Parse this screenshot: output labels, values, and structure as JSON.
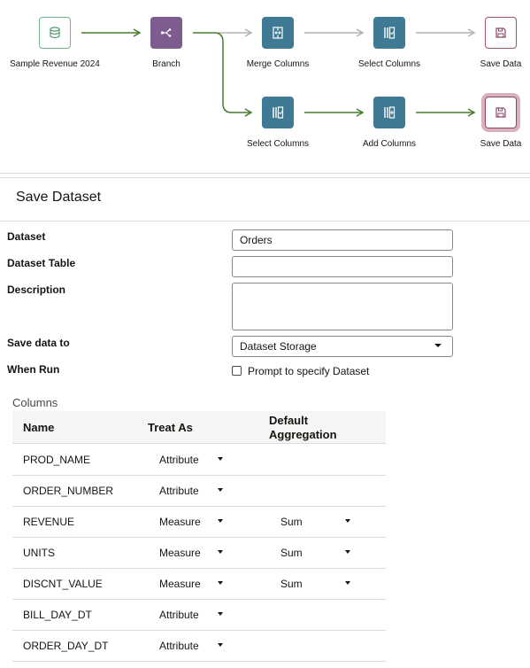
{
  "flow": {
    "nodes": [
      {
        "label": "Sample Revenue 2024",
        "icon": "database-icon"
      },
      {
        "label": "Branch",
        "icon": "branch-icon"
      },
      {
        "label": "Merge Columns",
        "icon": "merge-columns-icon"
      },
      {
        "label": "Select Columns",
        "icon": "select-columns-icon"
      },
      {
        "label": "Save Data",
        "icon": "save-icon"
      },
      {
        "label": "Select Columns",
        "icon": "select-columns-icon"
      },
      {
        "label": "Add Columns",
        "icon": "add-columns-icon"
      },
      {
        "label": "Save Data",
        "icon": "save-icon"
      }
    ],
    "colors": {
      "active_edge": "#4a7a2c",
      "inactive_edge": "#b5b3b0",
      "selected_ring": "#d8b2be"
    }
  },
  "panel": {
    "title": "Save Dataset",
    "dataset_label": "Dataset",
    "dataset_value": "Orders",
    "dataset_table_label": "Dataset Table",
    "dataset_table_value": "",
    "description_label": "Description",
    "description_value": "",
    "save_to_label": "Save data to",
    "save_to_value": "Dataset Storage",
    "when_run_label": "When Run",
    "prompt_label": "Prompt to specify Dataset",
    "prompt_checked": false
  },
  "columns": {
    "title": "Columns",
    "headers": {
      "name": "Name",
      "treat_as": "Treat As",
      "agg_line1": "Default",
      "agg_line2": "Aggregation"
    },
    "rows": [
      {
        "name": "PROD_NAME",
        "treat_as": "Attribute",
        "agg": ""
      },
      {
        "name": "ORDER_NUMBER",
        "treat_as": "Attribute",
        "agg": ""
      },
      {
        "name": "REVENUE",
        "treat_as": "Measure",
        "agg": "Sum"
      },
      {
        "name": "UNITS",
        "treat_as": "Measure",
        "agg": "Sum"
      },
      {
        "name": "DISCNT_VALUE",
        "treat_as": "Measure",
        "agg": "Sum"
      },
      {
        "name": "BILL_DAY_DT",
        "treat_as": "Attribute",
        "agg": ""
      },
      {
        "name": "ORDER_DAY_DT",
        "treat_as": "Attribute",
        "agg": ""
      }
    ]
  }
}
